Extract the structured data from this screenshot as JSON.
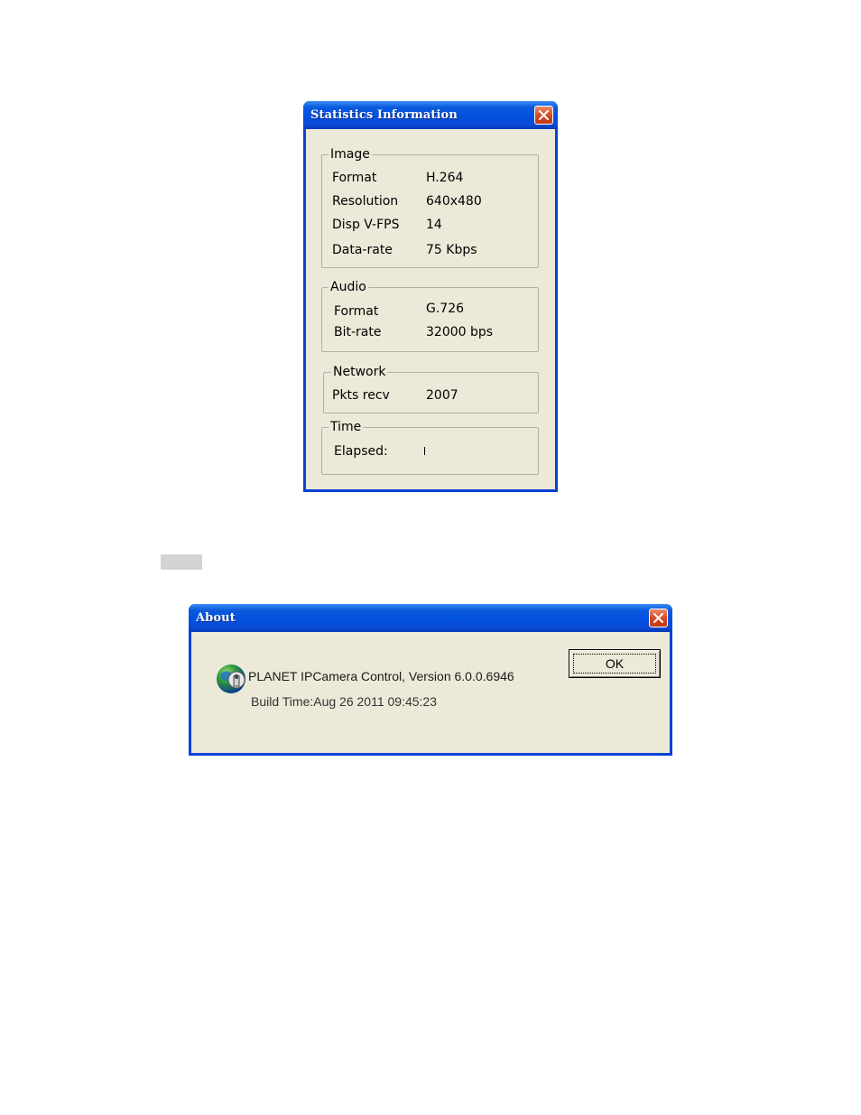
{
  "stats_window": {
    "title": "Statistics Information",
    "groups": {
      "image": {
        "title": "Image",
        "rows": [
          {
            "label": "Format",
            "value": "H.264"
          },
          {
            "label": "Resolution",
            "value": "640x480"
          },
          {
            "label": "Disp V-FPS",
            "value": "14"
          },
          {
            "label": "Data-rate",
            "value": "75 Kbps"
          }
        ]
      },
      "audio": {
        "title": "Audio",
        "rows": [
          {
            "label": "Format",
            "value": "G.726"
          },
          {
            "label": "Bit-rate",
            "value": "32000 bps"
          }
        ]
      },
      "network": {
        "title": "Network",
        "rows": [
          {
            "label": "Pkts recv",
            "value": "2007"
          }
        ]
      },
      "time": {
        "title": "Time",
        "rows": [
          {
            "label": "Elapsed:",
            "value": ""
          }
        ]
      }
    }
  },
  "about_window": {
    "title": "About",
    "line1": "PLANET IPCamera Control, Version 6.0.0.6946",
    "line2": "Build Time:Aug 26 2011  09:45:23",
    "ok_label": "OK",
    "icon": "planet-globe-icon"
  },
  "colors": {
    "titlebar": "#0151e0",
    "frame": "#0a42d6",
    "window_bg": "#ece9d8",
    "close_button": "#d6481f"
  }
}
